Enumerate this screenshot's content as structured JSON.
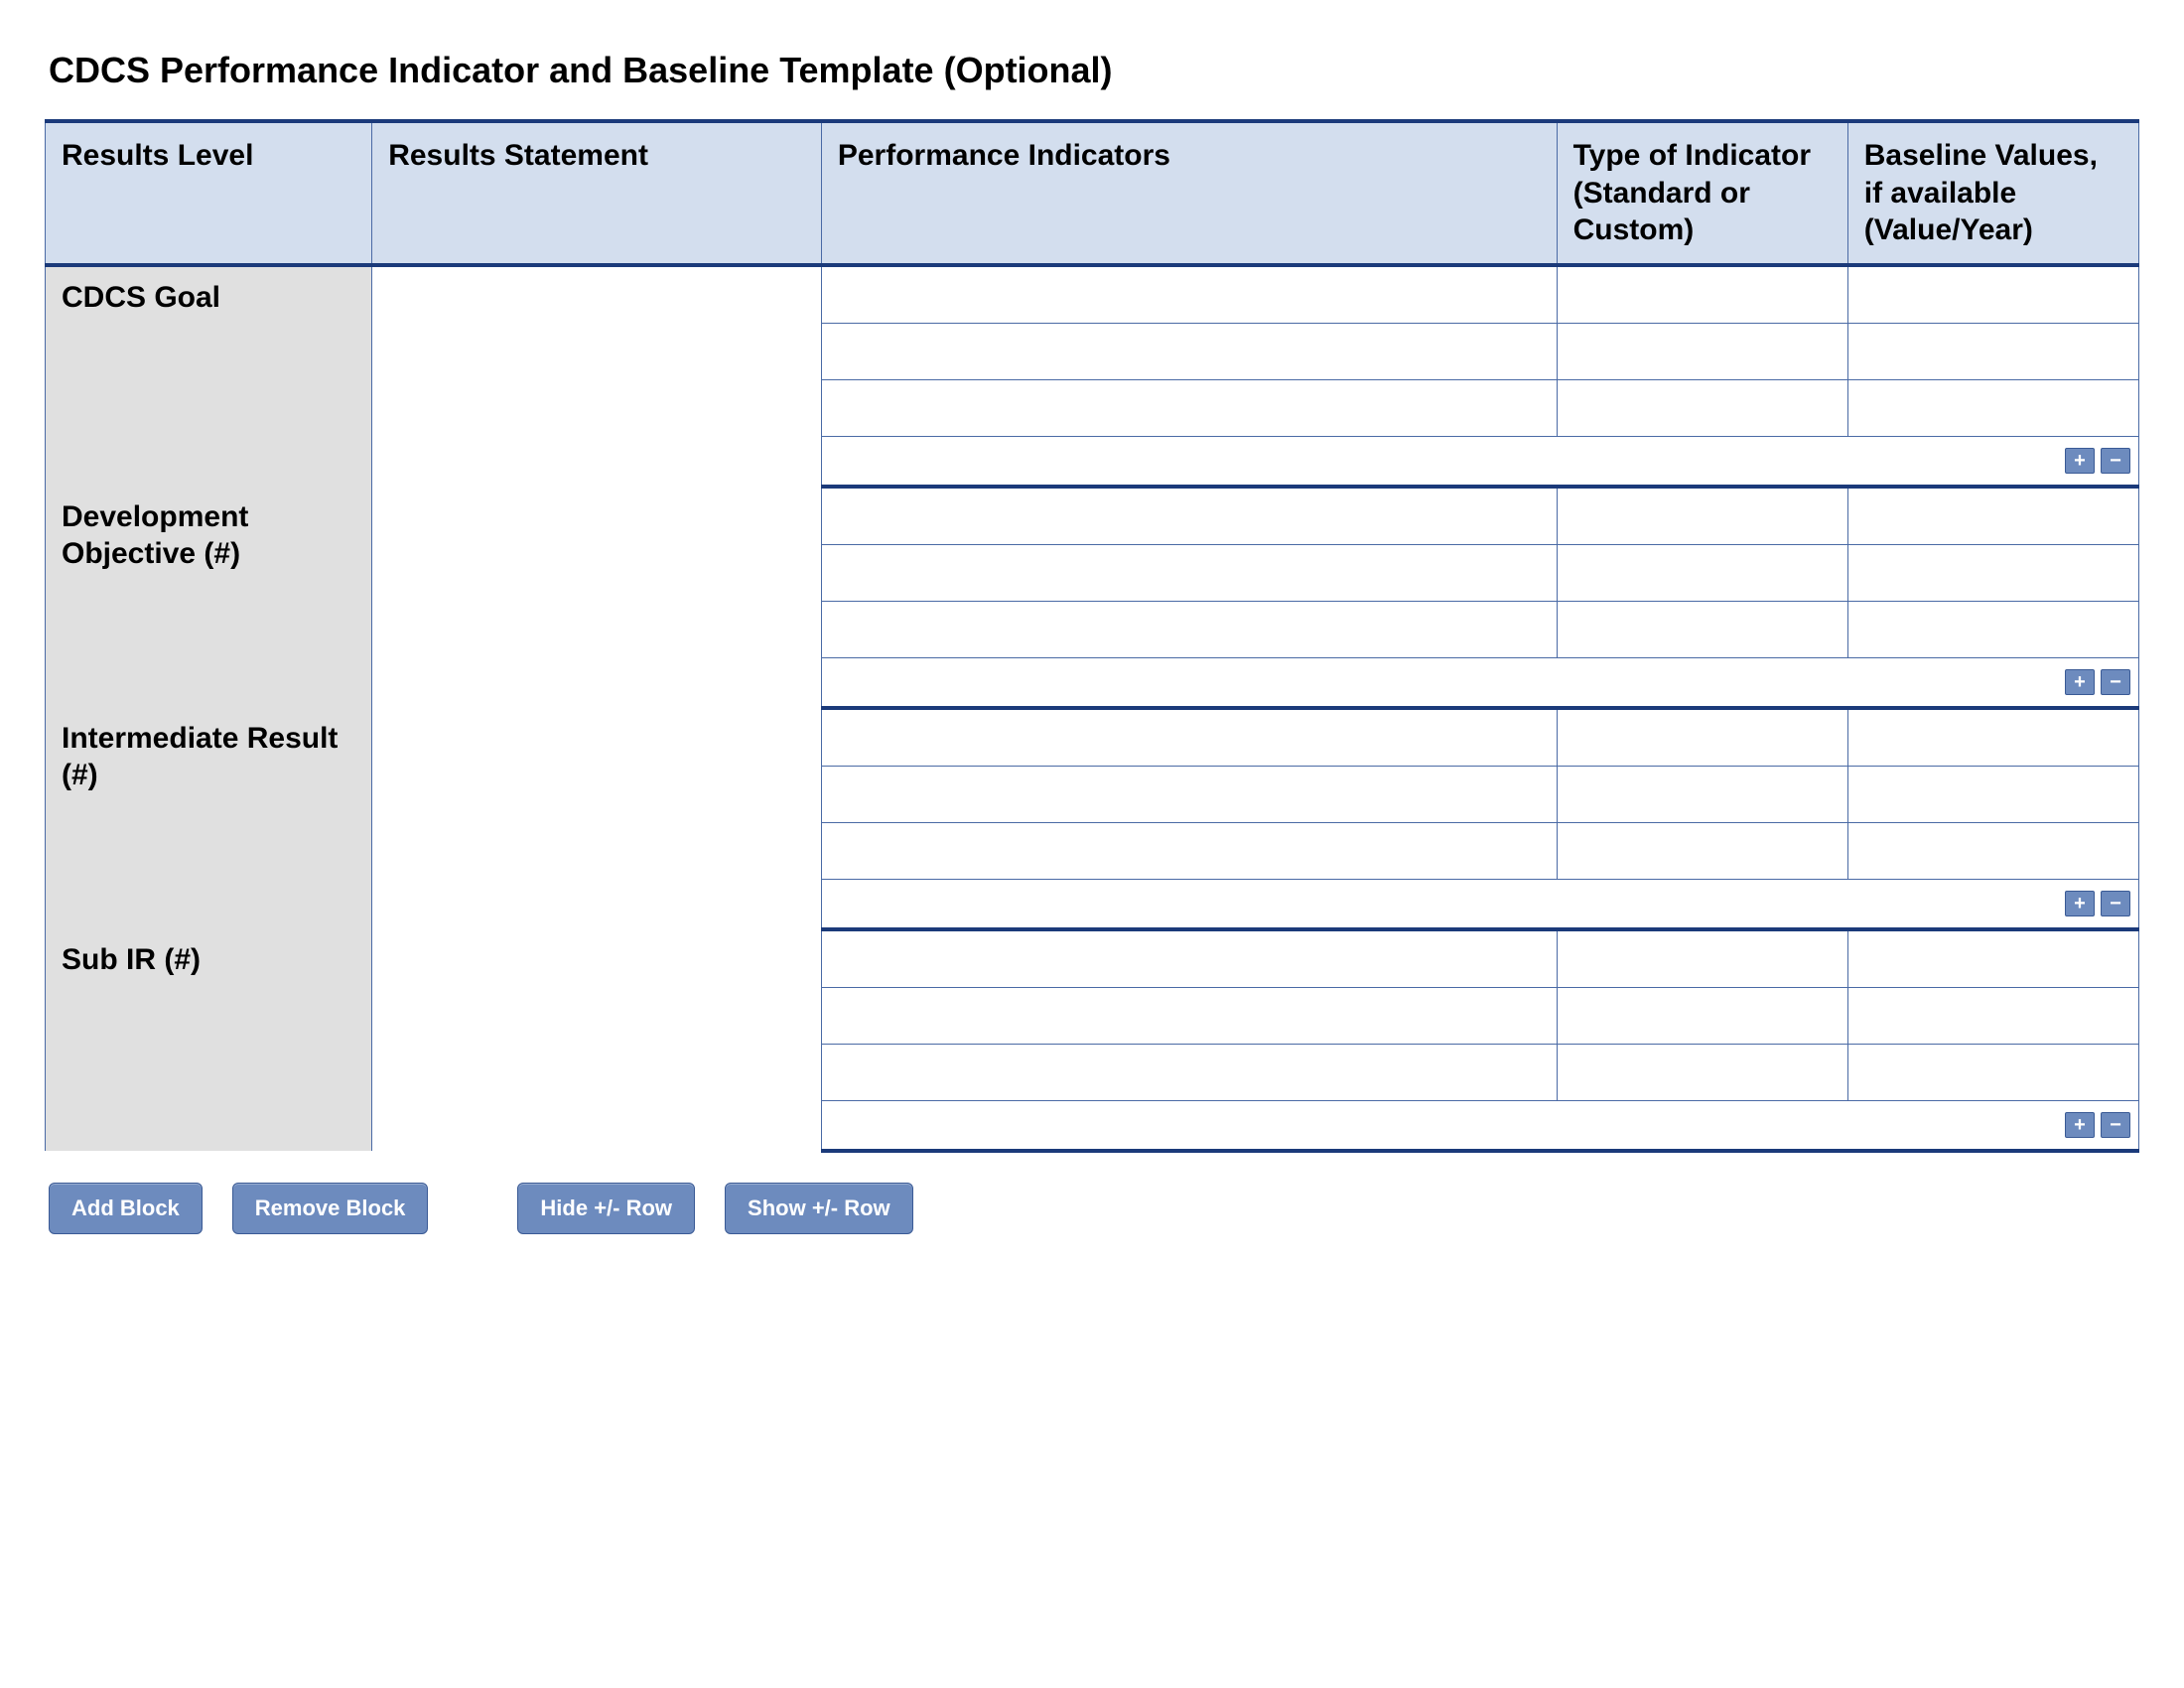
{
  "title": "CDCS Performance Indicator and Baseline Template (Optional)",
  "columns": {
    "results_level": "Results Level",
    "results_statement": "Results Statement",
    "performance_indicators": "Performance Indicators",
    "indicator_type": "Type of Indicator (Standard or Custom)",
    "baseline": "Baseline Values, if available (Value/Year)"
  },
  "sections": [
    {
      "label": "CDCS Goal",
      "statement": "",
      "rows": [
        {
          "indicator": "",
          "type": "",
          "baseline": ""
        },
        {
          "indicator": "",
          "type": "",
          "baseline": ""
        },
        {
          "indicator": "",
          "type": "",
          "baseline": ""
        }
      ]
    },
    {
      "label": "Development Objective (#)",
      "statement": "",
      "rows": [
        {
          "indicator": "",
          "type": "",
          "baseline": ""
        },
        {
          "indicator": "",
          "type": "",
          "baseline": ""
        },
        {
          "indicator": "",
          "type": "",
          "baseline": ""
        }
      ]
    },
    {
      "label": "Intermediate Result (#)",
      "statement": "",
      "rows": [
        {
          "indicator": "",
          "type": "",
          "baseline": ""
        },
        {
          "indicator": "",
          "type": "",
          "baseline": ""
        },
        {
          "indicator": "",
          "type": "",
          "baseline": ""
        }
      ]
    },
    {
      "label": "Sub IR (#)",
      "statement": "",
      "rows": [
        {
          "indicator": "",
          "type": "",
          "baseline": ""
        },
        {
          "indicator": "",
          "type": "",
          "baseline": ""
        },
        {
          "indicator": "",
          "type": "",
          "baseline": ""
        }
      ]
    }
  ],
  "pm_buttons": {
    "add": "+",
    "remove": "−"
  },
  "footer_buttons": {
    "add_block": "Add Block",
    "remove_block": "Remove Block",
    "hide_row": "Hide +/- Row",
    "show_row": "Show +/- Row"
  }
}
